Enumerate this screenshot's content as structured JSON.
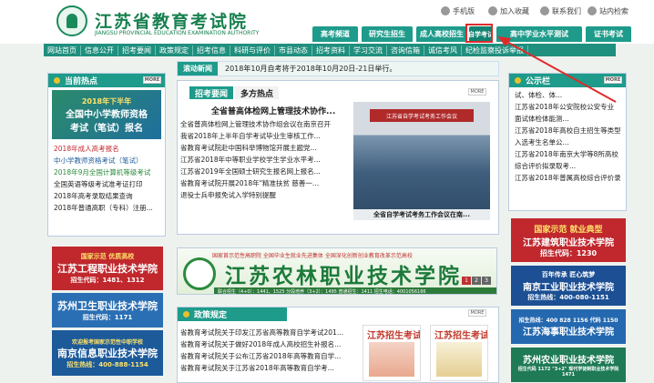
{
  "header": {
    "title_cn": "江苏省教育考试院",
    "title_en": "JIANGSU PROVINCIAL EDUCATION EXAMINATION AUTHORITY",
    "utilities": [
      {
        "icon": "mobile-icon",
        "label": "手机版"
      },
      {
        "icon": "star-icon",
        "label": "加入收藏"
      },
      {
        "icon": "contact-icon",
        "label": "联系我们"
      },
      {
        "icon": "search-icon",
        "label": "站内检索"
      }
    ],
    "main_tabs": [
      "高考频道",
      "研究生招生",
      "成人高校招生",
      "自学考试",
      "高中学业水平测试",
      "证书考试"
    ],
    "active_tab": "自学考试"
  },
  "nav": [
    "网站首页",
    "信息公开",
    "招考要闻",
    "政策规定",
    "招考信息",
    "科研与评价",
    "市县动态",
    "招考资料",
    "学习交流",
    "咨询信箱",
    "诚信考风",
    "纪检监察投诉举报"
  ],
  "left": {
    "section_title": "当前热点",
    "more": "MORE",
    "banner_line1": "2018年下半年",
    "banner_line2": "全国中小学教师资格",
    "banner_line3": "考试（笔试）报名",
    "items": [
      "2018年成人高考报名",
      "中小学教师资格考试（笔试）",
      "2018年9月全国计算机等级考试",
      "全国英语等级考试准考证打印",
      "2018年高考录取结果查询",
      "2018年普通高职（专科）注册..."
    ],
    "ads": [
      {
        "tag": "国家示范 优质高校",
        "name": "江苏工程职业技术学院",
        "phone": "招生代码：1481、1312",
        "bg": "#c0282d"
      },
      {
        "tag": "",
        "name": "苏州卫生职业技术学院",
        "phone": "招生代码：1171",
        "bg": "#2a6fb4"
      },
      {
        "tag": "欢迎报考国家示范性中职学校",
        "name": "南京信息职业技术学院",
        "phone": "招生热线：400-888-1154",
        "bg": "#1c5a9a"
      }
    ]
  },
  "center": {
    "ticker_label": "滚动新闻",
    "ticker_text": "2018年10月自考将于2018年10月20日-21日举行。",
    "tabs": [
      "招考要闻",
      "多方热点"
    ],
    "more": "MORE",
    "headline": "全省普高体检网上管理技术协作...",
    "items": [
      "全省普高体检网上管理技术协作组会议在南京召开",
      "我省2018年上半年自学考试毕业生审核工作...",
      "省教育考试院赴中国科举博物馆开展主题党...",
      "江苏省2018年中等职业学校学生学业水平考...",
      "江苏省2019年全国硕士研究生报名网上报名...",
      "省教育考试院开展2018年\"精准扶贫 慈善一...",
      "退役士兵申报免试入学特别提醒"
    ],
    "photo_stage": "江苏省自学考试考务工作会议",
    "photo_caption": "全省自学考试考务工作会议在南...",
    "wide_top": "国家首示范性高职院  全国毕业生就业先进集体  全国深化创新创业教育改革示范高校",
    "wide_name": "江苏农林职业技术学院",
    "wide_bottom": "联合招生（4+0）：1441、1525   分段培养（3+2）：1495   普通招生：1411   招生电话：4001056166",
    "pager": [
      "1",
      "2",
      "3"
    ],
    "policy_title": "政策规定",
    "policy_more": "MORE",
    "policy_items": [
      "省教育考试院关于印发江苏省高等教育自学考试201...",
      "省教育考试院关于做好2018年成人高校招生补报名...",
      "省教育考试院关于公布江苏省2018年高等教育自学...",
      "省教育考试院关于江苏省2018年高等教育自学考..."
    ],
    "thumb1_title": "江苏招生考试",
    "thumb2_title": "江苏招生考试"
  },
  "right": {
    "section_title": "公示栏",
    "more": "MORE",
    "items": [
      "试、体检、体...",
      "江苏省2018年公安院校公安专业",
      "面试体检体能测...",
      "江苏省2018年高校自主招生等类型",
      "入选考生名单公...",
      "江苏省2018年南京大学等8所高校",
      "综合评价拟录取考...",
      "江苏省2018年普属高校综合评价录"
    ],
    "ads": [
      {
        "line1": "国家示范  就业典型",
        "line2": "江苏建筑职业技术学院",
        "line3": "招生代码：1230",
        "bg": "#c0282d"
      },
      {
        "line1": "百年传承  匠心筑梦",
        "line2": "南京工业职业技术学院",
        "line3": "招生热线：400-080-1151",
        "bg": "#1c4f93"
      },
      {
        "line1": "招生热线：400 828 1156  代码 1150",
        "line2": "江苏海事职业技术学院",
        "line3": "",
        "bg": "#2468b0"
      },
      {
        "line1": "苏州农业职业技术学院",
        "line2": "招生代码 1172 \"3+2\" 现代学徒制职业技术学院 1471",
        "line3": "",
        "bg": "#1f7a56"
      }
    ]
  },
  "colors": {
    "accent": "#1e9b8b",
    "brand": "#17804f",
    "highlight": "#e02a2a"
  }
}
